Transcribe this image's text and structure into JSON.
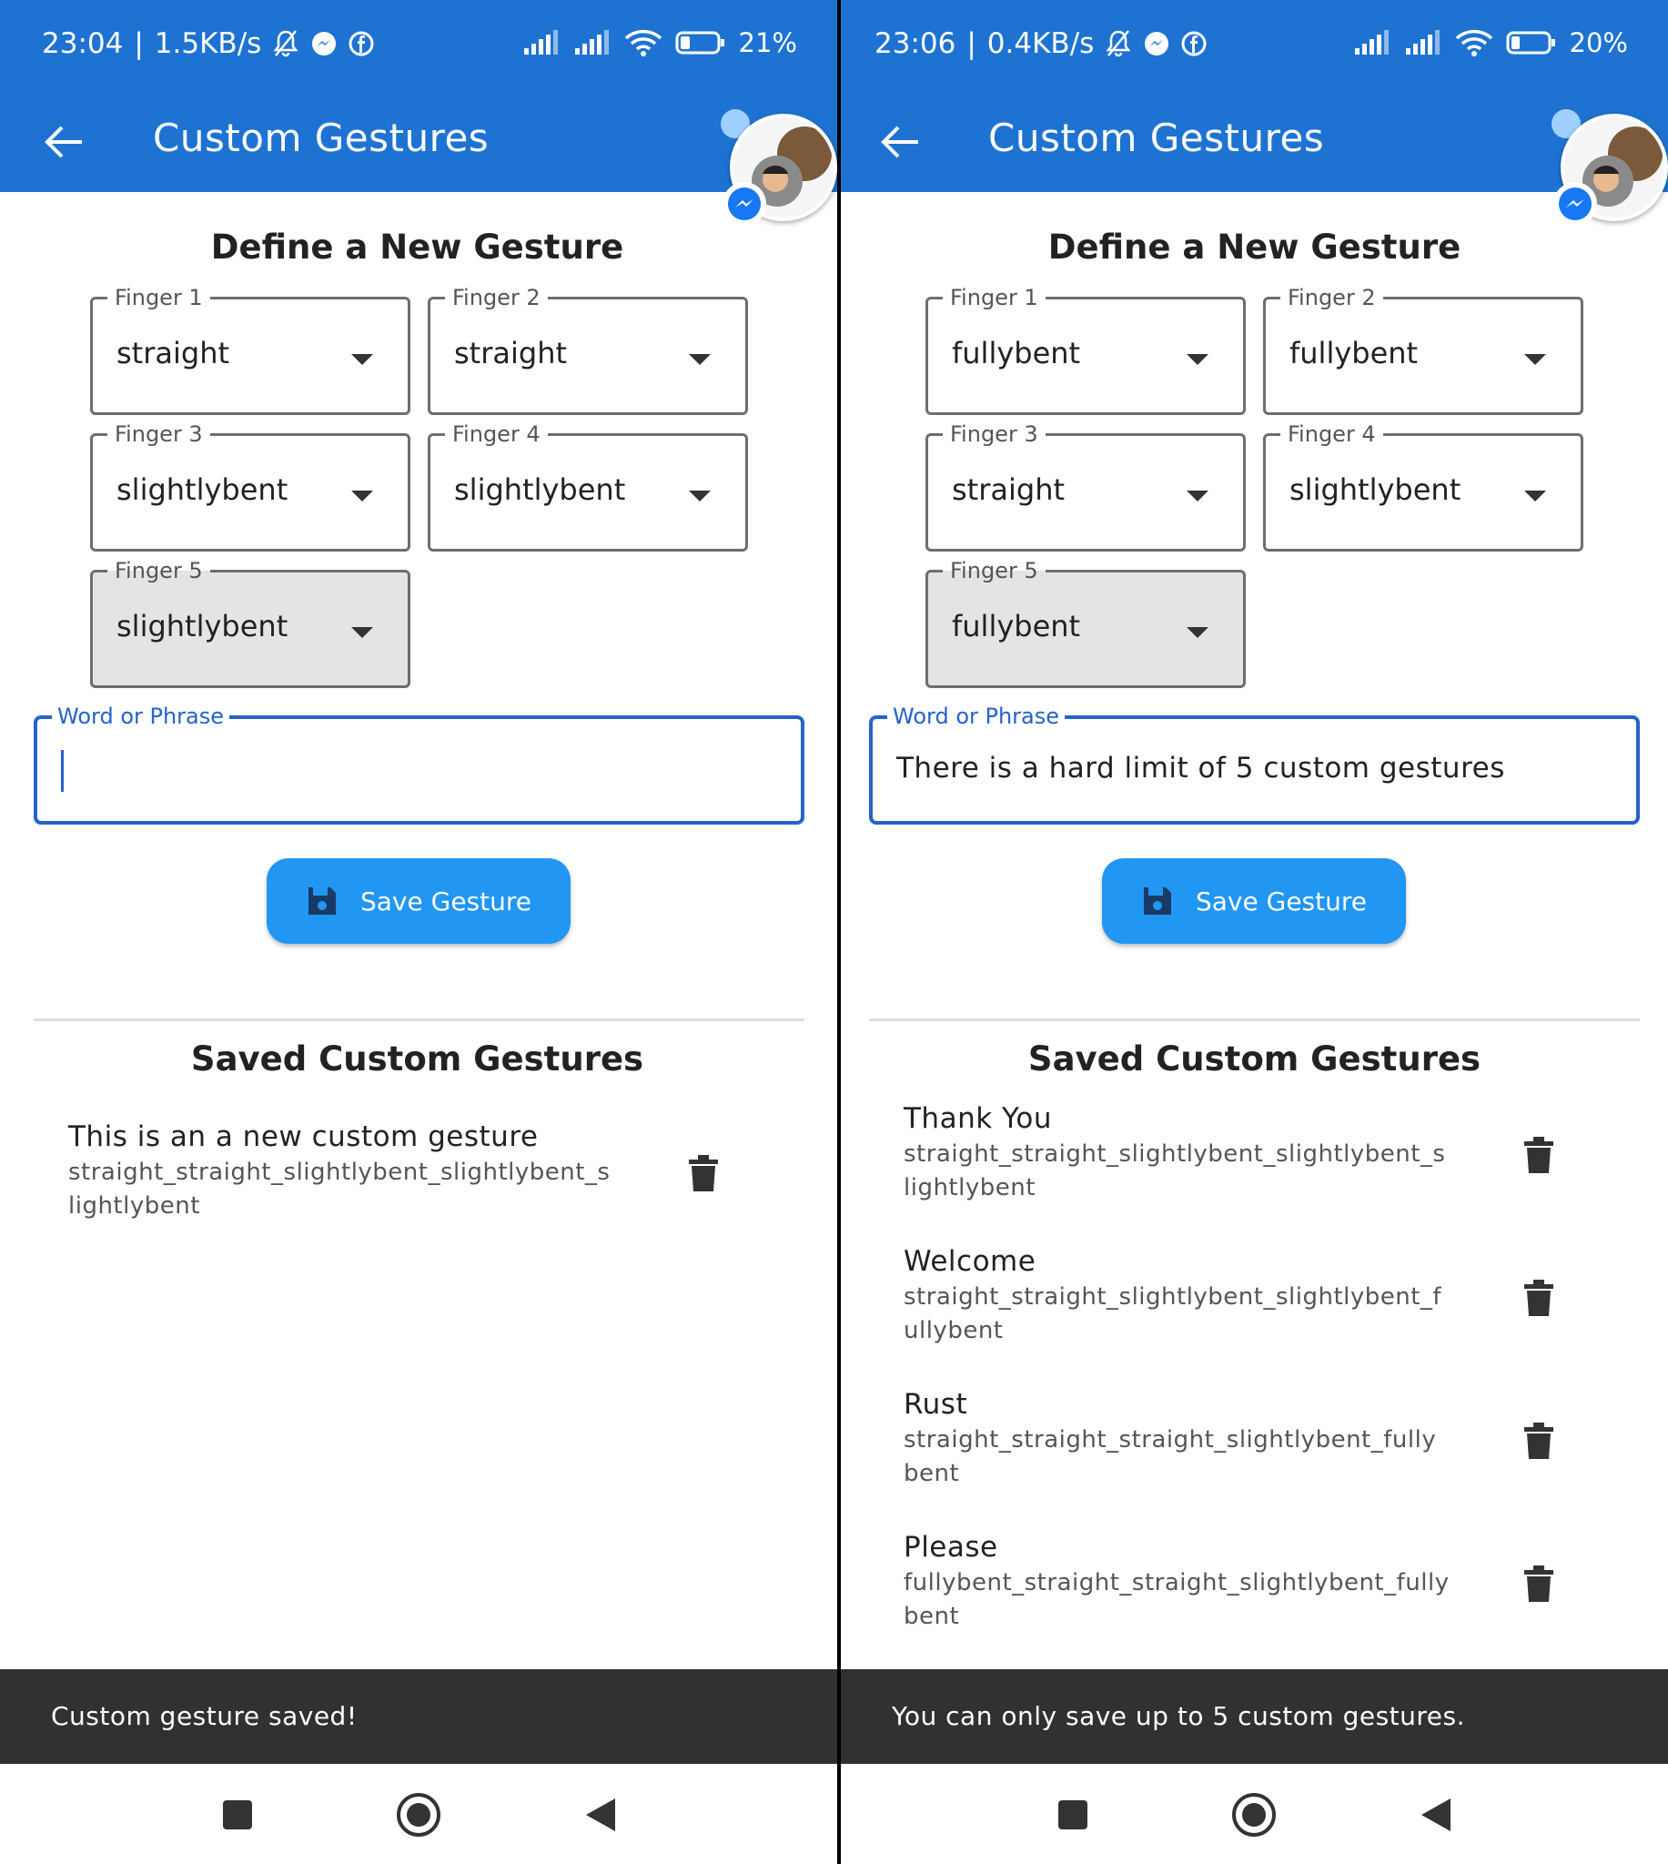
{
  "screens": [
    {
      "status": {
        "time": "23:04",
        "speed": "1.5KB/s",
        "battery": "21%"
      },
      "appbar": {
        "title": "Custom Gestures"
      },
      "define": {
        "title": "Define a New Gesture",
        "fingers": [
          {
            "label": "Finger 1",
            "value": "straight"
          },
          {
            "label": "Finger 2",
            "value": "straight"
          },
          {
            "label": "Finger 3",
            "value": "slightlybent"
          },
          {
            "label": "Finger 4",
            "value": "slightlybent"
          },
          {
            "label": "Finger 5",
            "value": "slightlybent"
          }
        ],
        "word_label": "Word or Phrase",
        "word_value": "",
        "save_label": "Save Gesture"
      },
      "saved": {
        "title": "Saved Custom Gestures",
        "items": [
          {
            "name": "This is an a new custom gesture",
            "pattern": "straight_straight_slightlybent_slightlybent_slightlybent"
          }
        ]
      },
      "snackbar": "Custom gesture saved!"
    },
    {
      "status": {
        "time": "23:06",
        "speed": "0.4KB/s",
        "battery": "20%"
      },
      "appbar": {
        "title": "Custom Gestures"
      },
      "define": {
        "title": "Define a New Gesture",
        "fingers": [
          {
            "label": "Finger 1",
            "value": "fullybent"
          },
          {
            "label": "Finger 2",
            "value": "fullybent"
          },
          {
            "label": "Finger 3",
            "value": "straight"
          },
          {
            "label": "Finger 4",
            "value": "slightlybent"
          },
          {
            "label": "Finger 5",
            "value": "fullybent"
          }
        ],
        "word_label": "Word or Phrase",
        "word_value": "There is a hard limit of 5 custom gestures",
        "save_label": "Save Gesture"
      },
      "saved": {
        "title": "Saved Custom Gestures",
        "items": [
          {
            "name": "Thank You",
            "pattern": "straight_straight_slightlybent_slightlybent_slightlybent"
          },
          {
            "name": "Welcome",
            "pattern": "straight_straight_slightlybent_slightlybent_fullybent"
          },
          {
            "name": "Rust",
            "pattern": "straight_straight_straight_slightlybent_fullybent"
          },
          {
            "name": "Please",
            "pattern": "fullybent_straight_straight_slightlybent_fullybent"
          }
        ]
      },
      "snackbar": "You can only save up to 5 custom gestures."
    }
  ],
  "colors": {
    "primary": "#1e73d2",
    "button": "#2196f3",
    "focus": "#2563c9",
    "snackbar": "#313131"
  },
  "icons": [
    "back-arrow-icon",
    "mute-bell-icon",
    "messenger-icon",
    "facebook-icon",
    "signal-icon",
    "wifi-icon",
    "battery-icon",
    "save-disk-icon",
    "trash-icon",
    "nav-recents-icon",
    "nav-home-icon",
    "nav-back-icon"
  ]
}
